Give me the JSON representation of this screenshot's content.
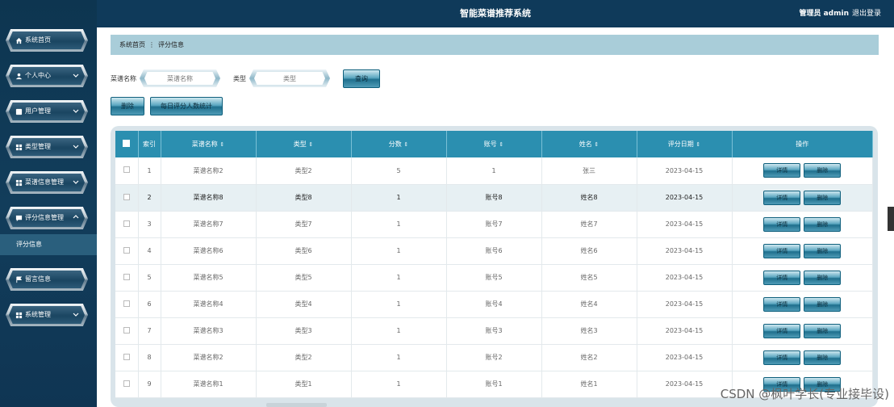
{
  "app_title": "智能菜谱推荐系统",
  "header": {
    "user": "管理员 admin",
    "logout": "退出登录"
  },
  "sidebar": {
    "items": [
      {
        "label": "系统首页",
        "icon": "home-icon"
      },
      {
        "label": "个人中心",
        "icon": "user-icon"
      },
      {
        "label": "用户管理",
        "icon": "user-admin-icon"
      },
      {
        "label": "类型管理",
        "icon": "grid-icon"
      },
      {
        "label": "菜谱信息管理",
        "icon": "grid-icon"
      },
      {
        "label": "评分信息管理",
        "icon": "comment-icon"
      },
      {
        "label": "留言信息",
        "icon": "flag-icon"
      },
      {
        "label": "系统管理",
        "icon": "grid-icon"
      }
    ],
    "sub_item": "评分信息"
  },
  "breadcrumb": {
    "home": "系统首页",
    "sep": "⋮",
    "current": "评分信息"
  },
  "search": {
    "name_label": "菜谱名称",
    "name_placeholder": "菜谱名称",
    "type_label": "类型",
    "type_placeholder": "类型",
    "query_button": "查询"
  },
  "actions": {
    "delete": "删除",
    "stats": "每日评分人数统计"
  },
  "table": {
    "headers": [
      "索引",
      "菜谱名称",
      "类型",
      "分数",
      "账号",
      "姓名",
      "评分日期",
      "操作"
    ],
    "detail_label": "详情",
    "delete_label": "删除",
    "rows": [
      {
        "idx": "1",
        "name": "菜谱名称2",
        "type": "类型2",
        "score": "5",
        "account": "1",
        "person": "张三",
        "date": "2023-04-15"
      },
      {
        "idx": "2",
        "name": "菜谱名称8",
        "type": "类型8",
        "score": "1",
        "account": "账号8",
        "person": "姓名8",
        "date": "2023-04-15"
      },
      {
        "idx": "3",
        "name": "菜谱名称7",
        "type": "类型7",
        "score": "1",
        "account": "账号7",
        "person": "姓名7",
        "date": "2023-04-15"
      },
      {
        "idx": "4",
        "name": "菜谱名称6",
        "type": "类型6",
        "score": "1",
        "account": "账号6",
        "person": "姓名6",
        "date": "2023-04-15"
      },
      {
        "idx": "5",
        "name": "菜谱名称5",
        "type": "类型5",
        "score": "1",
        "account": "账号5",
        "person": "姓名5",
        "date": "2023-04-15"
      },
      {
        "idx": "6",
        "name": "菜谱名称4",
        "type": "类型4",
        "score": "1",
        "account": "账号4",
        "person": "姓名4",
        "date": "2023-04-15"
      },
      {
        "idx": "7",
        "name": "菜谱名称3",
        "type": "类型3",
        "score": "1",
        "account": "账号3",
        "person": "姓名3",
        "date": "2023-04-15"
      },
      {
        "idx": "8",
        "name": "菜谱名称2",
        "type": "类型2",
        "score": "1",
        "account": "账号2",
        "person": "姓名2",
        "date": "2023-04-15"
      },
      {
        "idx": "9",
        "name": "菜谱名称1",
        "type": "类型1",
        "score": "1",
        "account": "账号1",
        "person": "姓名1",
        "date": "2023-04-15"
      }
    ]
  },
  "watermark": "CSDN @枫叶学长(专业接毕设)"
}
